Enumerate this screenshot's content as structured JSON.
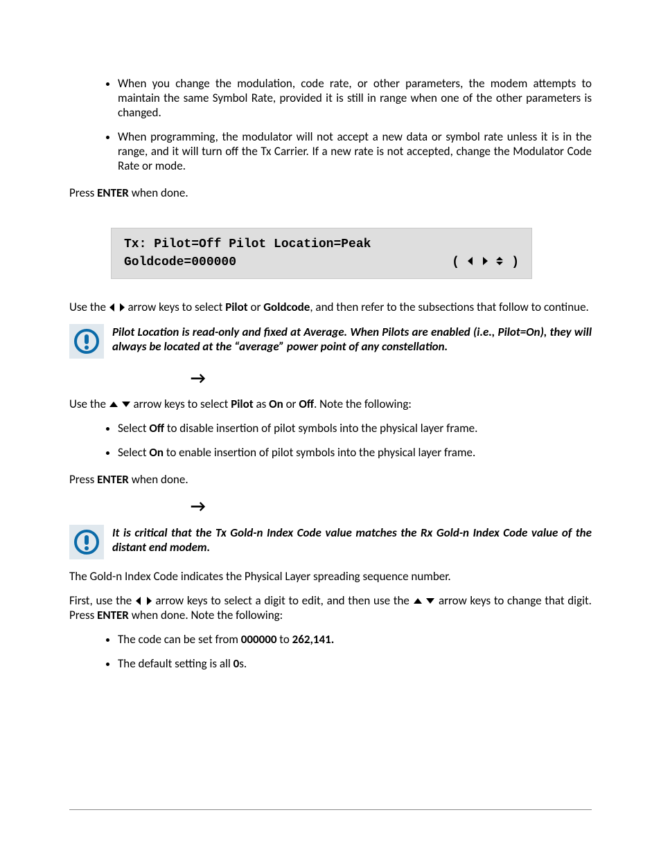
{
  "bullets_top": [
    "When you change the modulation, code rate, or other parameters, the modem attempts to maintain the same Symbol Rate, provided it is still in range when one of the other parameters is changed.",
    "When programming, the modulator will not accept a new data or symbol rate unless it is in the range, and it will turn off the Tx Carrier. If a new rate is not accepted, change the Modulator Code Rate or mode."
  ],
  "press_enter_1": {
    "pre": "Press ",
    "b": "ENTER",
    "post": " when done."
  },
  "screen": {
    "line1_full": "Tx: Pilot=Off   Pilot Location=Peak",
    "line2_left": "Goldcode=000000",
    "line2_right_open": "(",
    "line2_right_close": ")"
  },
  "use_lr": {
    "pre": "Use the ",
    "mid": " arrow keys to select ",
    "b1": "Pilot",
    "or": " or ",
    "b2": "Goldcode",
    "post": ", and then refer to the subsections that follow to continue."
  },
  "note1": "Pilot Location is read-only and fixed at Average. When Pilots are enabled (i.e., Pilot=On), they will always be located at the “average” power point of any constellation.",
  "use_ud": {
    "pre": "Use the ",
    "mid": " arrow keys to select ",
    "b1": "Pilot",
    "as": " as ",
    "b2": "On",
    "or": " or ",
    "b3": "Off",
    "post": ". Note the following:"
  },
  "bullets_mid": [
    {
      "pre": "Select ",
      "b": "Off",
      "post": " to disable insertion of pilot symbols into the physical layer frame."
    },
    {
      "pre": "Select ",
      "b": "On",
      "post": " to enable insertion of pilot symbols into the physical layer frame."
    }
  ],
  "press_enter_2": {
    "pre": "Press ",
    "b": "ENTER",
    "post": " when done."
  },
  "note2": "It is critical that the Tx Gold-n Index Code value matches the Rx Gold-n Index Code value of the distant end modem.",
  "gold_desc": "The Gold-n Index Code indicates the Physical Layer spreading sequence number.",
  "gold_edit": {
    "p1": "First, use the ",
    "p2": " arrow keys to select a digit to edit, and then use the ",
    "p3": " arrow keys to change that digit. Press ",
    "b": "ENTER",
    "p4": " when done. Note the following:"
  },
  "bullets_bottom": [
    {
      "pre": "The code can be set from ",
      "b1": "000000",
      "mid": " to ",
      "b2": "262,141."
    },
    {
      "pre": "The default setting is all ",
      "b": "0",
      "post": "s."
    }
  ],
  "arrow_right": "→"
}
